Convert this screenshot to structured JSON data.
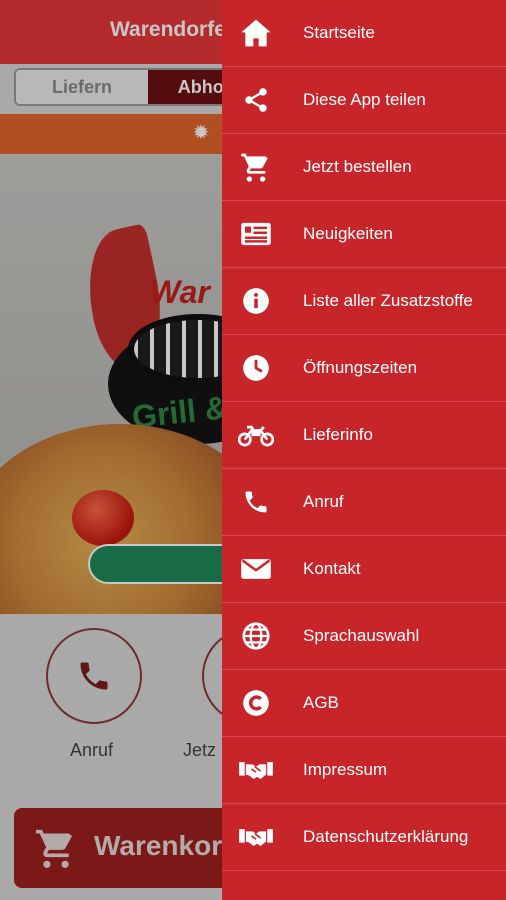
{
  "app": {
    "title": "Warendorfe",
    "order_mode": {
      "deliver": "Liefern",
      "pickup": "Abho"
    },
    "logo": {
      "word": "War",
      "sub": "Grill &"
    },
    "actions": [
      {
        "label": "Anruf",
        "icon": "phone-icon"
      },
      {
        "label": "Jetz",
        "icon": "order-icon"
      }
    ],
    "cart_button": {
      "label": "Warenkor",
      "icon": "cart-icon"
    },
    "colors": {
      "header": "#e8383a",
      "notice_bar": "#e0662c",
      "pickup_active": "#6e1010",
      "cart_button": "#9e1f1f"
    }
  },
  "drawer": {
    "background": "#c8252b",
    "items": [
      {
        "label": "Startseite",
        "icon": "home-icon"
      },
      {
        "label": "Diese App teilen",
        "icon": "share-icon"
      },
      {
        "label": "Jetzt bestellen",
        "icon": "cart-icon"
      },
      {
        "label": "Neuigkeiten",
        "icon": "news-icon"
      },
      {
        "label": "Liste aller Zusatzstoffe",
        "icon": "info-icon"
      },
      {
        "label": "Öffnungszeiten",
        "icon": "clock-icon"
      },
      {
        "label": "Lieferinfo",
        "icon": "motorbike-icon"
      },
      {
        "label": "Anruf",
        "icon": "phone-icon"
      },
      {
        "label": "Kontakt",
        "icon": "mail-icon"
      },
      {
        "label": "Sprachauswahl",
        "icon": "globe-icon"
      },
      {
        "label": "AGB",
        "icon": "copyright-icon"
      },
      {
        "label": "Impressum",
        "icon": "handshake-icon"
      },
      {
        "label": "Datenschutzerklärung",
        "icon": "handshake-icon"
      }
    ]
  }
}
